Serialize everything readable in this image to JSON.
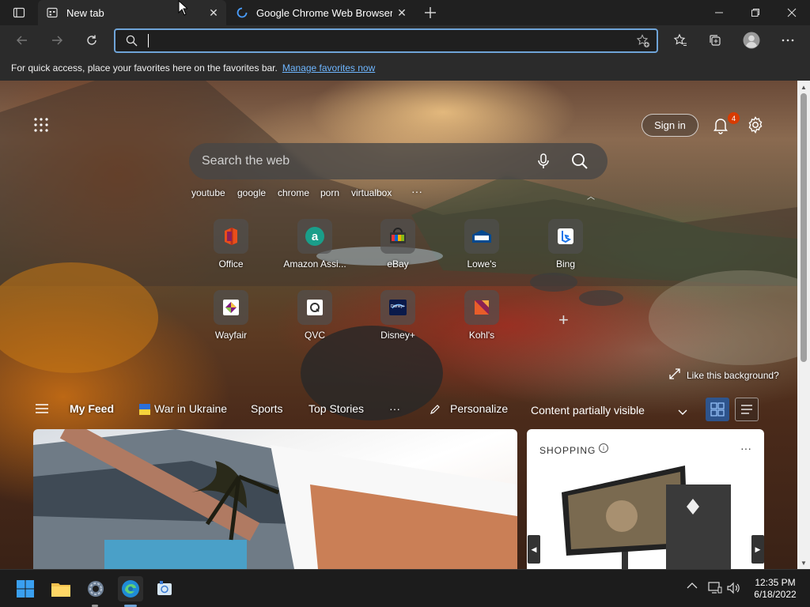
{
  "tabs": [
    {
      "label": "New tab",
      "active": true
    },
    {
      "label": "Google Chrome Web Browser",
      "active": false
    }
  ],
  "address_bar": {
    "value": "",
    "placeholder": ""
  },
  "favorites_bar": {
    "message": "For quick access, place your favorites here on the favorites bar.",
    "link": "Manage favorites now"
  },
  "header": {
    "sign_in": "Sign in",
    "notification_count": "4"
  },
  "search": {
    "placeholder": "Search the web"
  },
  "quick_links": [
    "youtube",
    "google",
    "chrome",
    "porn",
    "virtualbox",
    "···"
  ],
  "tiles": [
    {
      "label": "Office",
      "icon": "office-icon"
    },
    {
      "label": "Amazon Assi...",
      "icon": "amazon-icon"
    },
    {
      "label": "eBay",
      "icon": "ebay-icon"
    },
    {
      "label": "Lowe's",
      "icon": "lowes-icon"
    },
    {
      "label": "Bing",
      "icon": "bing-icon"
    },
    {
      "label": "Wayfair",
      "icon": "wayfair-icon"
    },
    {
      "label": "QVC",
      "icon": "qvc-icon"
    },
    {
      "label": "Disney+",
      "icon": "disney-plus-icon"
    },
    {
      "label": "Kohl's",
      "icon": "kohls-icon"
    }
  ],
  "background": {
    "like_label": "Like this background?"
  },
  "feed": {
    "my_feed": "My Feed",
    "war_in_ukraine": "War in Ukraine",
    "sports": "Sports",
    "top_stories": "Top Stories",
    "more": "···",
    "personalize": "Personalize",
    "content_visibility": "Content partially visible"
  },
  "shopping_card": {
    "label": "SHOPPING",
    "more": "···"
  },
  "taskbar": {
    "time": "12:35 PM",
    "date": "6/18/2022"
  },
  "colors": {
    "accent": "#6fa4d8",
    "link": "#6eb6ff",
    "badge": "#d83b01"
  }
}
